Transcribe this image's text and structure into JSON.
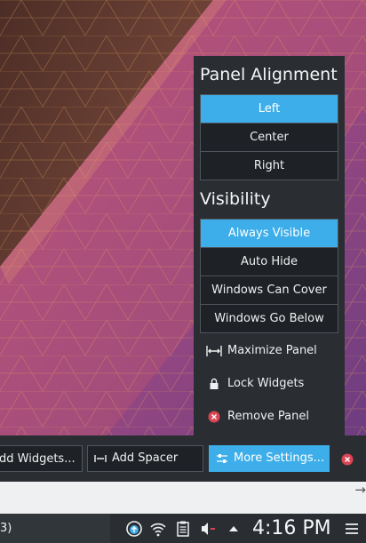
{
  "colors": {
    "accent": "#3daee9",
    "popup_bg": "#2a2e32",
    "remove_red": "#da4453"
  },
  "panel_alignment": {
    "title": "Panel Alignment",
    "options": [
      "Left",
      "Center",
      "Right"
    ],
    "selected": "Left"
  },
  "visibility": {
    "title": "Visibility",
    "options": [
      "Always Visible",
      "Auto Hide",
      "Windows Can Cover",
      "Windows Go Below"
    ],
    "selected": "Always Visible"
  },
  "actions": [
    {
      "label": "Maximize Panel",
      "icon": "maximize-icon"
    },
    {
      "label": "Lock Widgets",
      "icon": "lock-icon"
    },
    {
      "label": "Remove Panel",
      "icon": "remove-icon"
    }
  ],
  "toolbar": {
    "add_widgets_label": "dd Widgets...",
    "add_spacer_label": "Add Spacer",
    "more_settings_label": "More Settings..."
  },
  "taskbar": {
    "task_label": "3)",
    "clock": "4:16 PM",
    "tray_icons": [
      "updates-icon",
      "wifi-icon",
      "clipboard-icon",
      "volume-muted-icon",
      "expand-tray-icon",
      "menu-icon"
    ]
  }
}
